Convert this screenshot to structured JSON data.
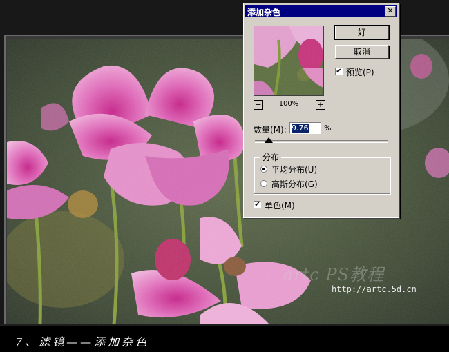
{
  "dialog": {
    "title": "添加杂色",
    "close_glyph": "✕",
    "ok_label": "好",
    "cancel_label": "取消",
    "preview_label": "预览(P)",
    "preview_checked": true,
    "zoom_minus": "−",
    "zoom_plus": "+",
    "zoom_level": "100%",
    "amount_label": "数量(M):",
    "amount_value": "9.76",
    "amount_unit": "%",
    "distribution_title": "分布",
    "uniform_label": "平均分布(U)",
    "gaussian_label": "高斯分布(G)",
    "selected_distribution": "uniform",
    "monochrome_label": "单色(M)",
    "monochrome_checked": true,
    "check_glyph": "✔"
  },
  "image": {
    "watermark": "artc PS教程",
    "url": "http://artc.5d.cn",
    "caption": "7、滤镜——添加杂色"
  },
  "colors": {
    "titlebar": "#000080",
    "dialog_bg": "#d4d0c8",
    "flower_pink": "#e060b0",
    "selection": "#0a246a"
  }
}
